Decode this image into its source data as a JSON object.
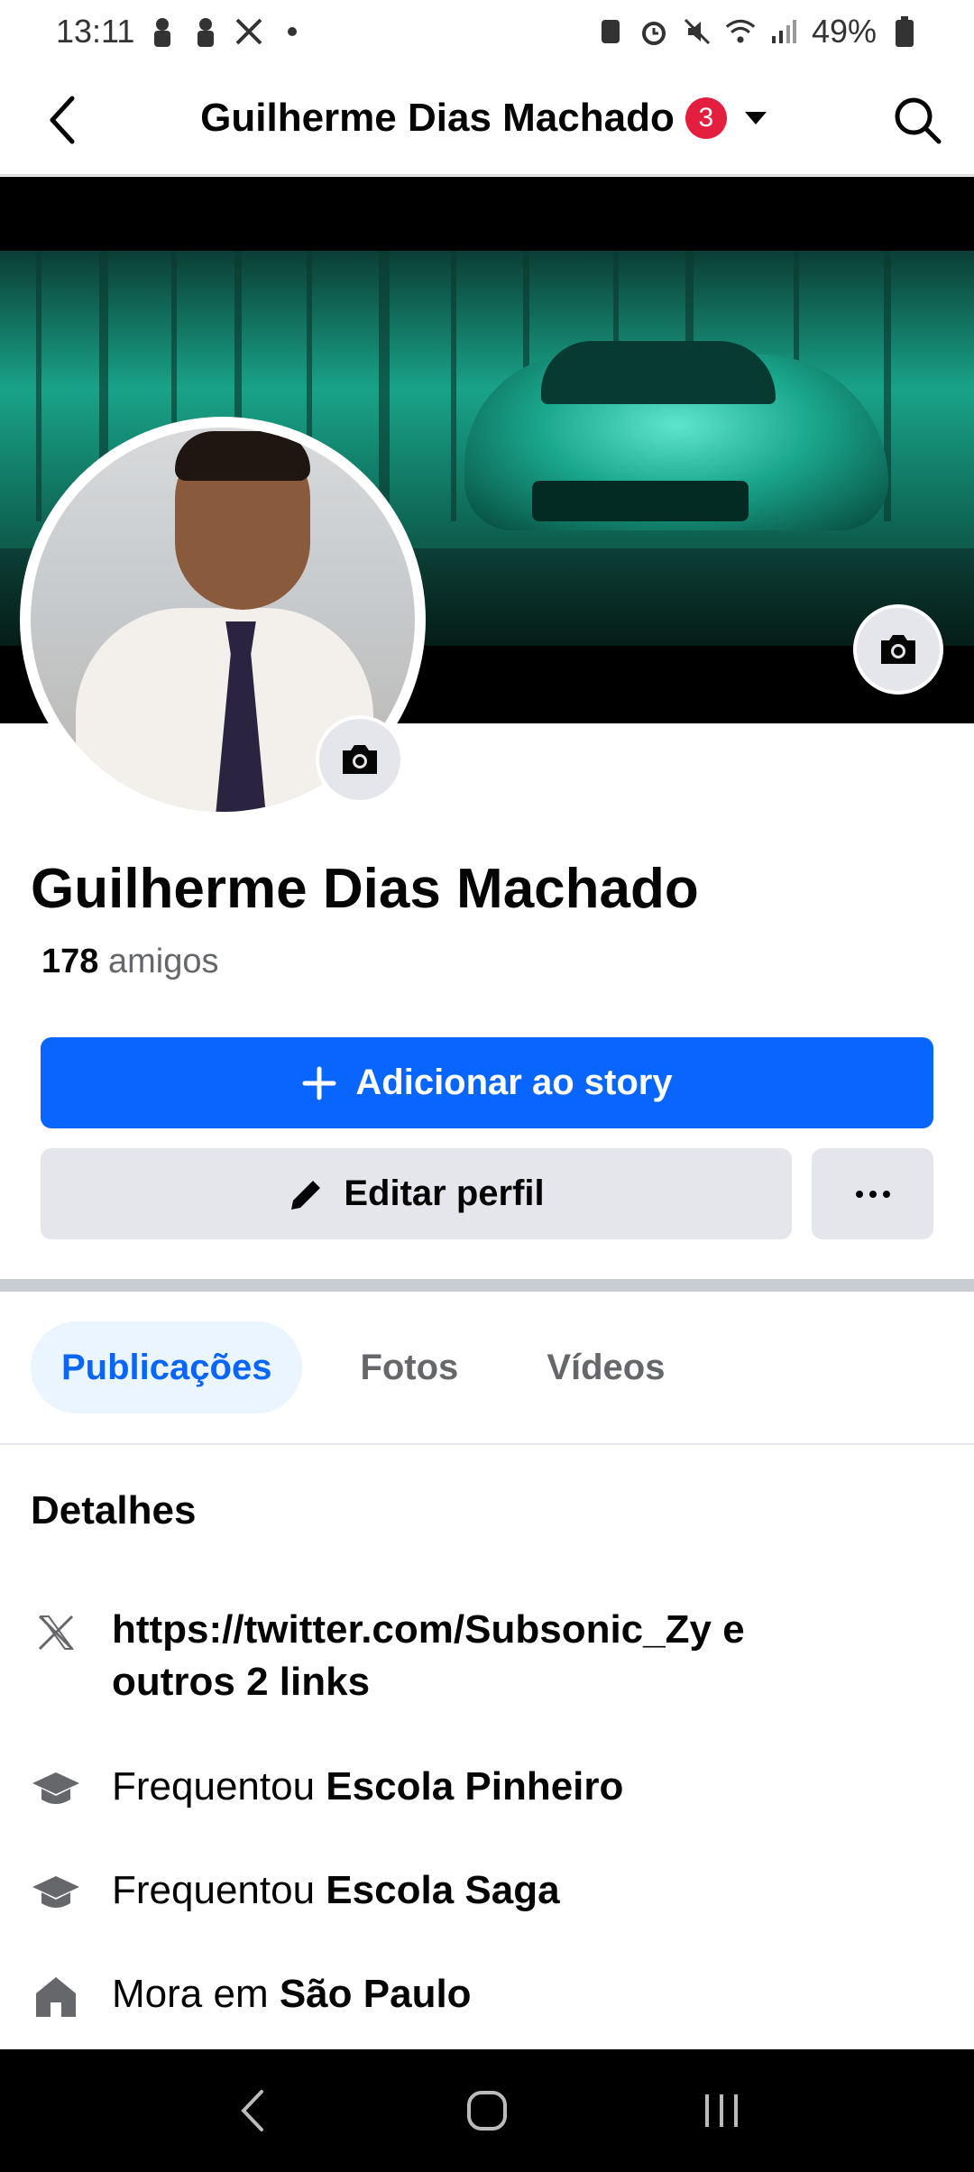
{
  "status_bar": {
    "time": "13:11",
    "battery": "49%",
    "left_icons": [
      "person-icon",
      "person-icon",
      "x-logo-icon",
      "dot-icon"
    ],
    "right_icons": [
      "nfc-icon",
      "alarm-icon",
      "mute-icon",
      "wifi-icon",
      "signal-icon",
      "battery-icon"
    ]
  },
  "nav": {
    "title": "Guilherme Dias Machado",
    "badge": "3"
  },
  "profile": {
    "name": "Guilherme Dias Machado",
    "friends_count": "178",
    "friends_label": "amigos"
  },
  "actions": {
    "story_label": "Adicionar ao story",
    "edit_label": "Editar perfil"
  },
  "tabs": [
    {
      "label": "Publicações",
      "active": true
    },
    {
      "label": "Fotos",
      "active": false
    },
    {
      "label": "Vídeos",
      "active": false
    }
  ],
  "details": {
    "title": "Detalhes",
    "links_line1": "https://twitter.com/Subsonic_Zy e",
    "links_line2": "outros 2 links",
    "school1_prefix": "Frequentou",
    "school1_name": "Escola Pinheiro",
    "school2_prefix": "Frequentou",
    "school2_name": "Escola Saga",
    "home_prefix": "Mora em",
    "home_name": "São Paulo"
  },
  "colors": {
    "accent": "#0866ff",
    "badge": "#e41e3f",
    "button_gray": "#e4e6eb",
    "tab_active_bg": "#ebf5ff"
  }
}
